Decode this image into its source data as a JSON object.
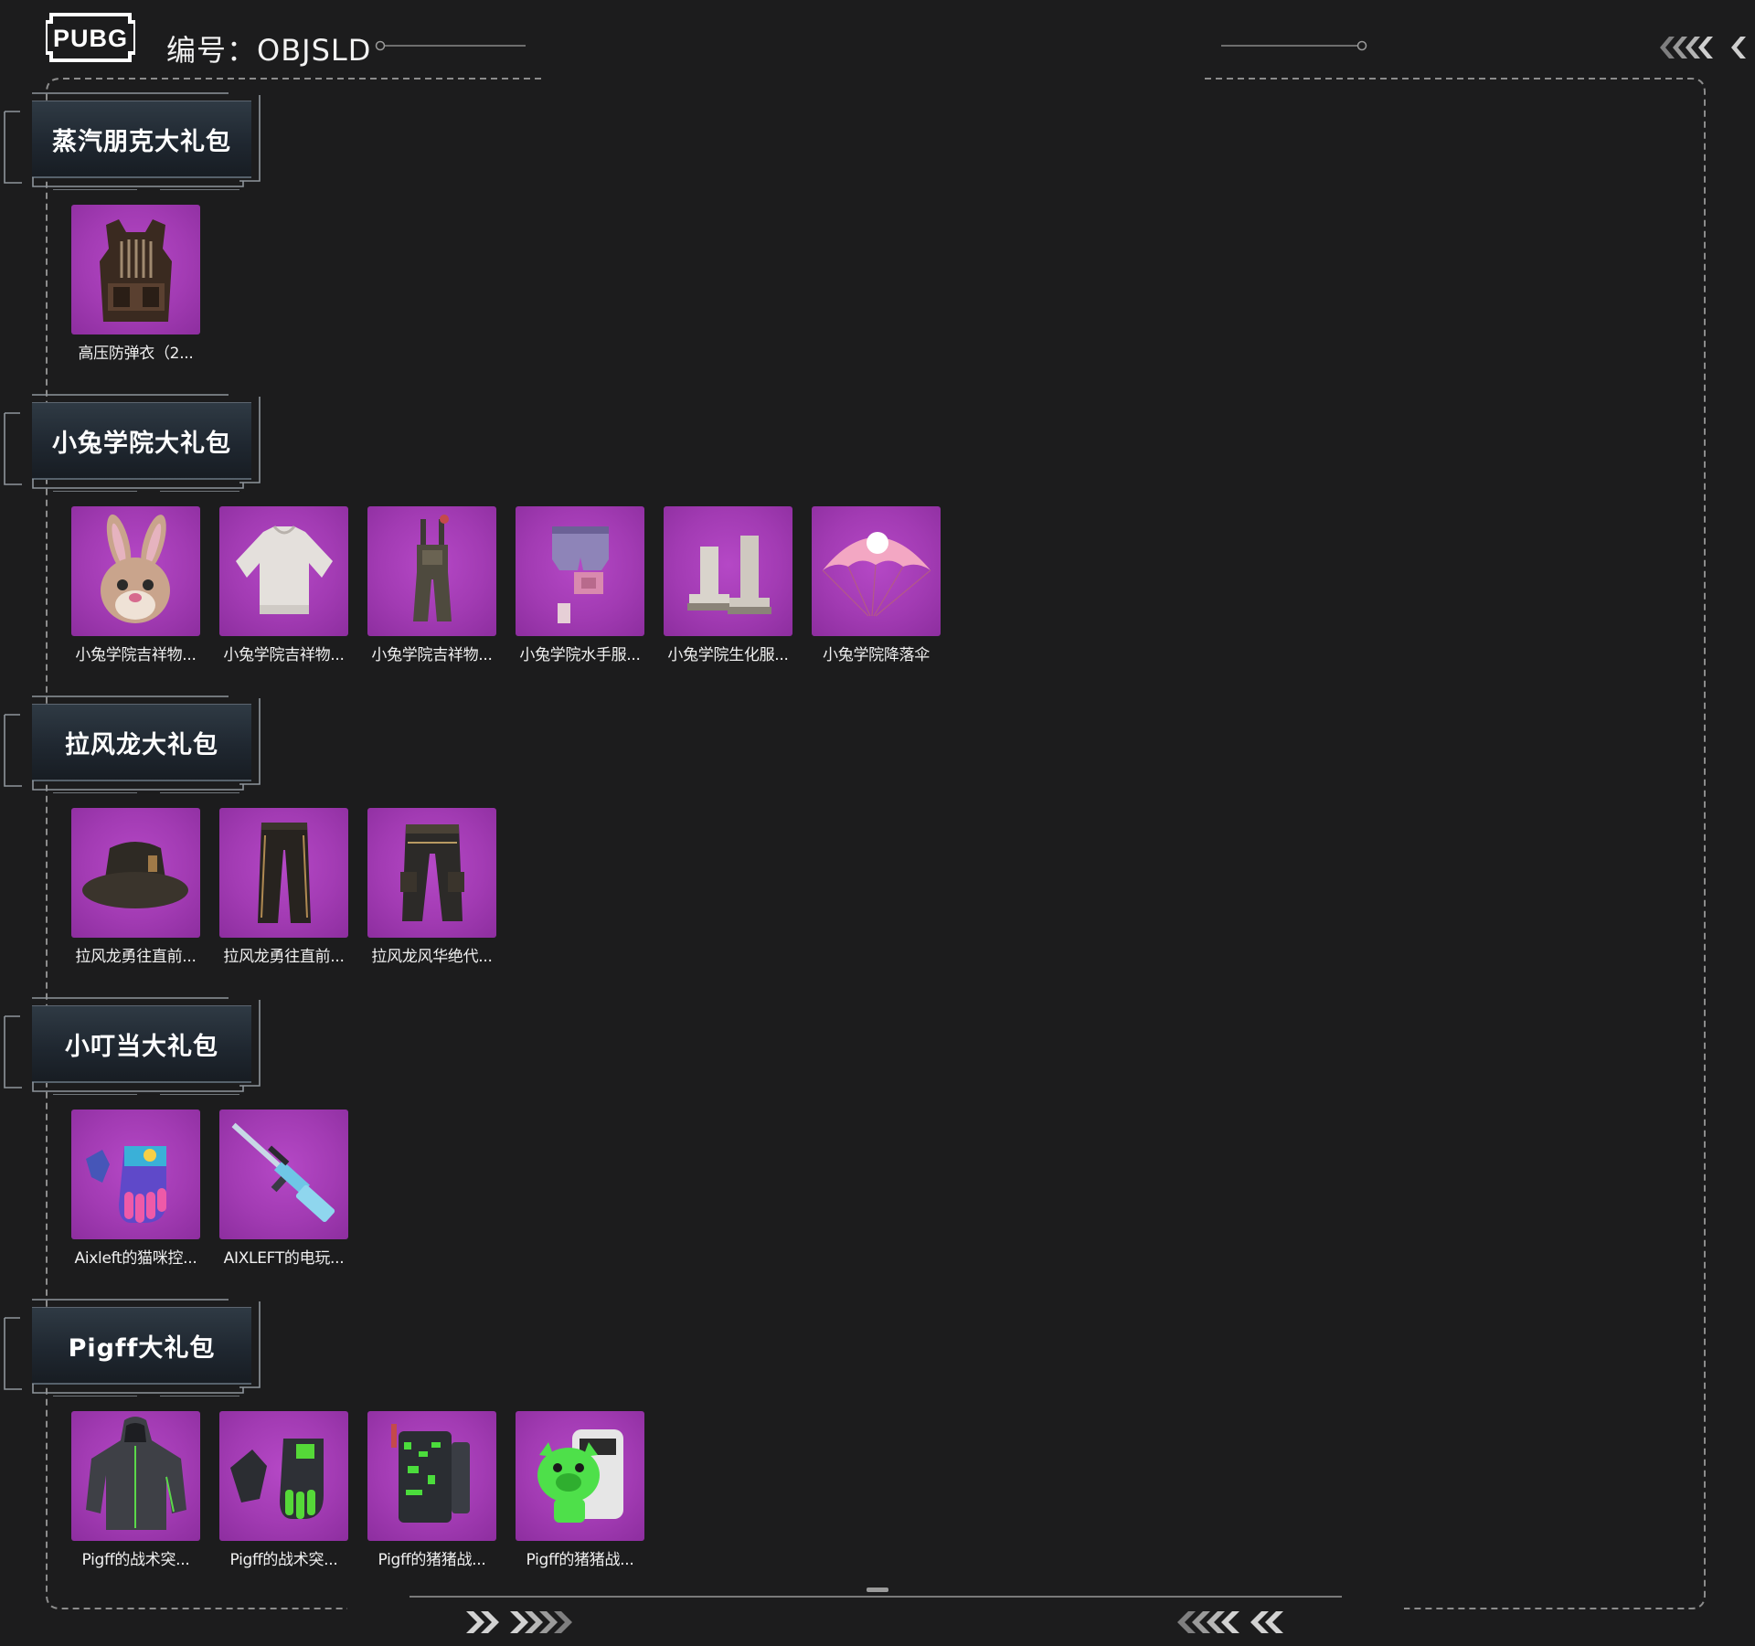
{
  "header": {
    "logo_text": "PUBG",
    "title": "编号：OBJSLD"
  },
  "sections": [
    {
      "title": "蒸汽朋克大礼包",
      "items": [
        {
          "name": "高压防弹衣（2...",
          "icon": "armor-vest-icon"
        }
      ]
    },
    {
      "title": "小兔学院大礼包",
      "items": [
        {
          "name": "小兔学院吉祥物...",
          "icon": "bunny-mask-icon"
        },
        {
          "name": "小兔学院吉祥物...",
          "icon": "sweater-icon"
        },
        {
          "name": "小兔学院吉祥物...",
          "icon": "overalls-icon"
        },
        {
          "name": "小兔学院水手服...",
          "icon": "shorts-icon"
        },
        {
          "name": "小兔学院生化服...",
          "icon": "boots-icon"
        },
        {
          "name": "小兔学院降落伞",
          "icon": "parachute-icon"
        }
      ]
    },
    {
      "title": "拉风龙大礼包",
      "items": [
        {
          "name": "拉风龙勇往直前...",
          "icon": "bucket-hat-icon"
        },
        {
          "name": "拉风龙勇往直前...",
          "icon": "pants-icon"
        },
        {
          "name": "拉风龙风华绝代...",
          "icon": "cargo-pants-icon"
        }
      ]
    },
    {
      "title": "小叮当大礼包",
      "items": [
        {
          "name": "Aixleft的猫咪控...",
          "icon": "gloves-icon"
        },
        {
          "name": "AIXLEFT的电玩...",
          "icon": "rifle-icon"
        }
      ]
    },
    {
      "title": "Pigff大礼包",
      "items": [
        {
          "name": "Pigff的战术突...",
          "icon": "hooded-jacket-icon"
        },
        {
          "name": "Pigff的战术突...",
          "icon": "tactical-gloves-icon"
        },
        {
          "name": "Pigff的猪猪战...",
          "icon": "backpack-icon"
        },
        {
          "name": "Pigff的猪猪战...",
          "icon": "pig-backpack-icon"
        }
      ]
    }
  ],
  "colors": {
    "background": "#1c1c1d",
    "thumb": "#a23bb3",
    "frame": "#8c8c8c"
  }
}
